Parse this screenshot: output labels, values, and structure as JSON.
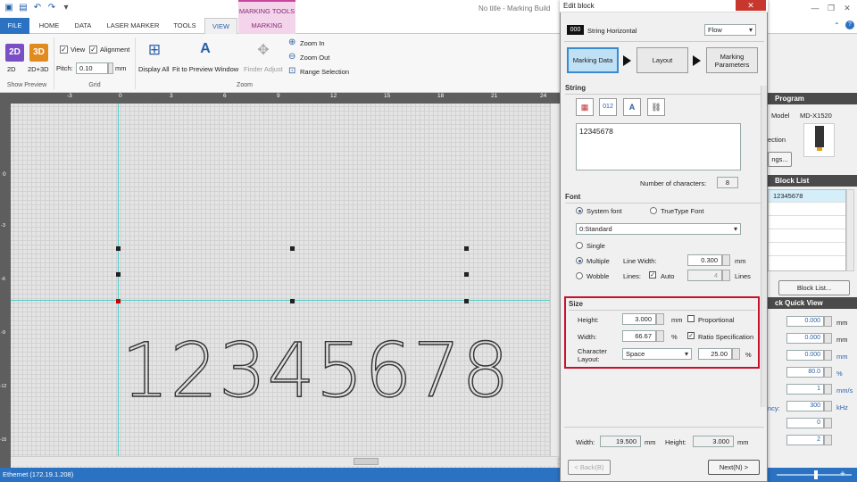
{
  "window": {
    "title": "No title - Marking Build",
    "marking_tools_label": "MARKING TOOLS"
  },
  "tabs": [
    {
      "label": "FILE"
    },
    {
      "label": "HOME"
    },
    {
      "label": "DATA"
    },
    {
      "label": "LASER MARKER"
    },
    {
      "label": "TOOLS"
    },
    {
      "label": "VIEW"
    },
    {
      "label": "MARKING"
    }
  ],
  "ribbon": {
    "show_preview": {
      "btn_2d": "2D",
      "btn_3d": "3D",
      "label_2d3d": "2D+3D",
      "group_label": "Show Preview"
    },
    "grid": {
      "view_label": "View",
      "alignment_label": "Alignment",
      "pitch_label": "Pitch:",
      "pitch_value": "0.10",
      "pitch_unit": "mm",
      "group_label": "Grid"
    },
    "zoom": {
      "display_all": "Display All",
      "fit_preview": "Fit to Preview Window",
      "finder_adjust": "Finder Adjust",
      "zoom_in": "Zoom In",
      "zoom_out": "Zoom Out",
      "range_selection": "Range Selection",
      "group_label": "Zoom"
    }
  },
  "canvas": {
    "marking_text": "12345678",
    "ruler_top": [
      "-3",
      "0",
      "3",
      "6",
      "9",
      "12",
      "15",
      "18",
      "21",
      "24"
    ],
    "ruler_left": [
      "0",
      "-3",
      "-6",
      "-9",
      "-12",
      "-15"
    ]
  },
  "status": {
    "text": "Ethernet (172.19.1.208)"
  },
  "right_panel": {
    "program_head": "Program",
    "model_label": "Model",
    "model_value": "MD-X1520",
    "section_text": "ection",
    "settings_btn": "ngs...",
    "block_list_head": "Block List",
    "block_list_items": [
      "12345678",
      "",
      "",
      "",
      "",
      ""
    ],
    "block_list_btn": "Block List...",
    "quick_view_head": "ck Quick View",
    "quick_rows": [
      {
        "value": "0.000",
        "unit": "mm",
        "label": ""
      },
      {
        "value": "0.000",
        "unit": "mm",
        "label": ""
      },
      {
        "value": "0.000",
        "unit": "mm",
        "label": ""
      },
      {
        "value": "80.0",
        "unit": "%",
        "label": ""
      },
      {
        "value": "1",
        "unit": "mm/s",
        "label": ""
      },
      {
        "value": "300",
        "unit": "kHz",
        "label": "ncy:"
      },
      {
        "value": "0",
        "unit": "",
        "label": ""
      },
      {
        "value": "2",
        "unit": "",
        "label": ""
      }
    ]
  },
  "dialog": {
    "title": "Edit block",
    "close": "✕",
    "block_type_badge": "000",
    "block_type": "String Horizontal",
    "flow_select": "Flow",
    "steps": [
      "Marking Data",
      "Layout",
      "Marking Parameters"
    ],
    "string_section": "String",
    "string_icons": [
      "calendar-icon",
      "counter-icon",
      "text-format-icon",
      "link-icon"
    ],
    "string_icon_glyphs": [
      "▦",
      "012",
      "A",
      "⛓"
    ],
    "string_value": "12345678",
    "num_chars_label": "Number of characters:",
    "num_chars_value": "8",
    "font_section": "Font",
    "system_font": "System font",
    "truetype_font": "TrueType Font",
    "font_select": "0:Standard",
    "single": "Single",
    "multiple": "Multiple",
    "wobble": "Wobble",
    "line_width_label": "Line Width:",
    "line_width_value": "0.300",
    "line_width_unit": "mm",
    "lines_label": "Lines:",
    "auto_label": "Auto",
    "lines_value": "4",
    "lines_unit": "Lines",
    "size_section": "Size",
    "height_label": "Height:",
    "height_value": "3.000",
    "height_unit": "mm",
    "proportional": "Proportional",
    "width_label": "Width:",
    "width_value": "66.67",
    "width_unit": "%",
    "ratio_spec": "Ratio Specification",
    "char_layout_label": "Character Layout:",
    "char_layout_select": "Space",
    "char_layout_value": "25.00",
    "char_layout_unit": "%",
    "footer_width_label": "Width:",
    "footer_width_value": "19.500",
    "footer_width_unit": "mm",
    "footer_height_label": "Height:",
    "footer_height_value": "3.000",
    "footer_height_unit": "mm",
    "back_btn": "< Back(B)",
    "next_btn": "Next(N) >"
  },
  "colors": {
    "accent": "#2b72c2",
    "highlight_border": "#c8102e",
    "marking_tab": "#f3d4ea"
  }
}
